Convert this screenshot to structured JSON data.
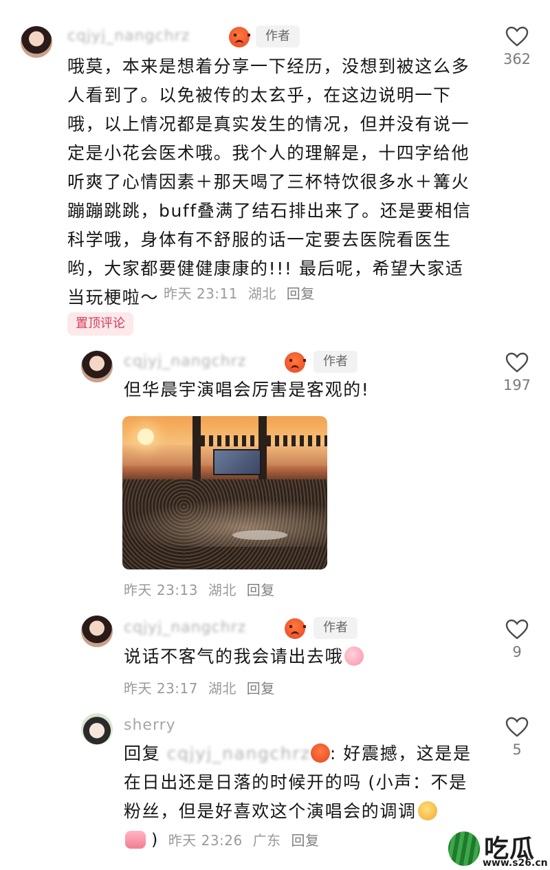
{
  "comments": [
    {
      "username": "cqjyj_nangchrz",
      "author_label": "作者",
      "text": "哦莫，本来是想着分享一下经历，没想到被这么多人看到了。以免被传的太玄乎，在这边说明一下哦，以上情况都是真实发生的情况，但并没有说一定是小花会医术哦。我个人的理解是，十四字给他听爽了心情因素＋那天喝了三杯特饮很多水＋篝火蹦蹦跳跳，buff叠满了结石排出来了。还是要相信科学哦，身体有不舒服的话一定要去医院看医生哟，大家都要健健康康的!!! 最后呢，希望大家适当玩梗啦～",
      "time": "昨天 23:11",
      "location": "湖北",
      "reply_label": "回复",
      "likes": "362",
      "pinned_label": "置顶评论"
    },
    {
      "username": "cqjyj_nangchrz",
      "author_label": "作者",
      "text": "但华晨宇演唱会厉害是客观的!",
      "time": "昨天 23:13",
      "location": "湖北",
      "reply_label": "回复",
      "likes": "197"
    },
    {
      "username": "cqjyj_nangchrz",
      "author_label": "作者",
      "text": "说话不客气的我会请出去哦",
      "time": "昨天 23:17",
      "location": "湖北",
      "reply_label": "回复",
      "likes": "9"
    },
    {
      "username": "sherry",
      "reply_prefix": "回复",
      "reply_to": "cqjyj_nangchrz",
      "text": ": 好震撼，这是是在日出还是日落的时候开的吗 (小声：不是粉丝，但是好喜欢这个演唱会的调调",
      "time_suffix": ")",
      "time": "昨天 23:26",
      "location": "广东",
      "reply_label": "回复",
      "likes": "5"
    }
  ],
  "watermark": {
    "title": "吃瓜网",
    "url": "www.s26.cn"
  },
  "icons": {
    "like": "heart-outline-icon",
    "angry": "angry-face-icon",
    "peach": "peach-emoji-icon",
    "drool": "drooling-face-icon",
    "thumb": "thumbs-emoji-icon"
  }
}
